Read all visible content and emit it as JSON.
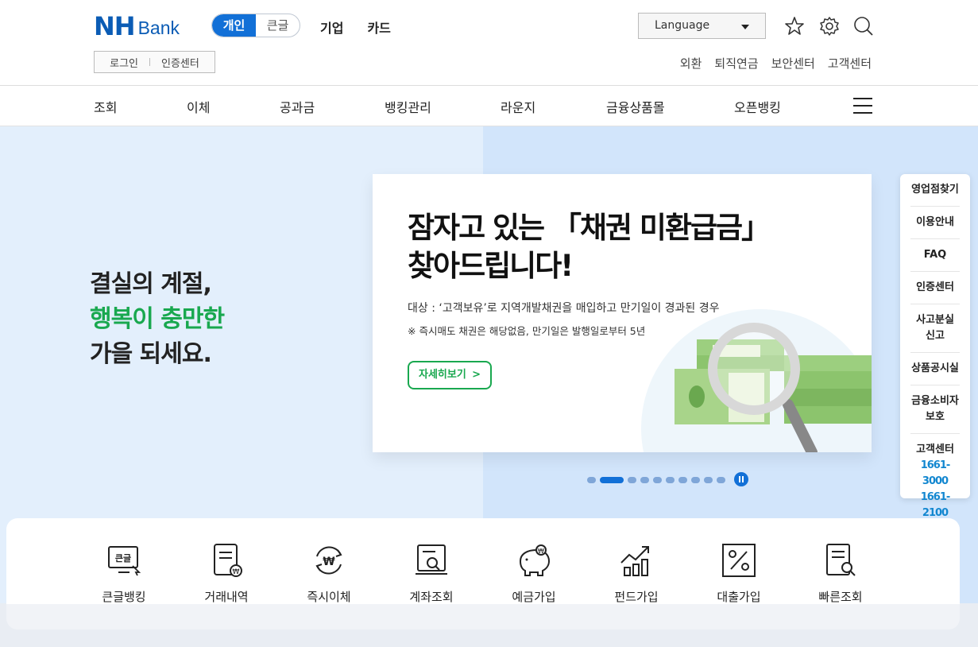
{
  "header": {
    "logo": {
      "nh": "NH",
      "bank": "Bank"
    },
    "segment": {
      "personal": "개인",
      "large": "큰글"
    },
    "topnav": [
      "기업",
      "카드"
    ],
    "login": "로그인",
    "cert": "인증센터",
    "language": "Language",
    "util": [
      "외환",
      "퇴직연금",
      "보안센터",
      "고객센터"
    ]
  },
  "gnb": [
    "조회",
    "이체",
    "공과금",
    "뱅킹관리",
    "라운지",
    "금융상품몰",
    "오픈뱅킹"
  ],
  "hero": {
    "line1": "결실의 계절,",
    "line2": "행복이 충만한",
    "line3": "가을 되세요."
  },
  "banner": {
    "title1": "잠자고 있는 「채권 미환급금」",
    "title2": "찾아드립니다!",
    "sub1": "대상 : ‘고객보유’로 지역개발채권을 매입하고 만기일이 경과된 경우",
    "sub2": "※ 즉시매도 채권은 해당없음, 만기일은 발행일로부터 5년",
    "button": "자세히보기",
    "button_arrow": ">"
  },
  "carousel": {
    "count": 10,
    "active": 1
  },
  "quick": [
    "큰글뱅킹",
    "거래내역",
    "즉시이체",
    "계좌조회",
    "예금가입",
    "펀드가입",
    "대출가입",
    "빠른조회"
  ],
  "side": {
    "items": [
      "영업점찾기",
      "이용안내",
      "FAQ",
      "인증센터",
      "사고분실 신고",
      "상품공시실",
      "금융소비자 보호",
      "고객센터"
    ],
    "phones": [
      "1661-3000",
      "1661-2100"
    ]
  },
  "colors": {
    "brand": "#0b5cb5",
    "accent": "#1270d7",
    "green": "#19a84f"
  }
}
